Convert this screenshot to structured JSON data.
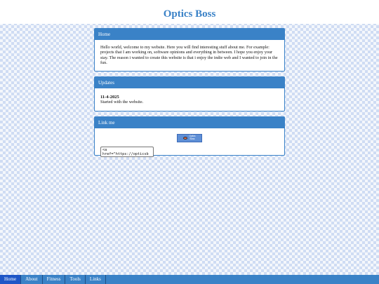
{
  "site": {
    "title": "Optics Boss"
  },
  "home": {
    "heading": "Home",
    "text": "Hello world, welcome to my website. Here you will find interesting stuff about me. For example: projects that I am working on, software opinions and everything in between. I hope you enjoy your stay. The reason i wanted to create this website is that i enjoy the indie web and I wanted to join in the fun."
  },
  "updates": {
    "heading": "Updates",
    "items": [
      {
        "date": "11-4-2025",
        "text": "Started with the website."
      }
    ]
  },
  "link_me": {
    "heading": "Link me",
    "button_line1": "Optics",
    "button_line2": "Boss",
    "code": "<a\nhref=\"https://opticsb"
  },
  "nav": {
    "items": [
      "Home",
      "About",
      "Fitness",
      "Tools",
      "Links"
    ],
    "active": "Home"
  },
  "colors": {
    "accent": "#3a82c7",
    "nav_active": "#1e56c7",
    "background_check": "#cfdcf3"
  }
}
